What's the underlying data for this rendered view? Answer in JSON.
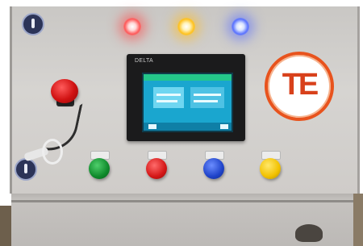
{
  "hmi": {
    "brand_text": "DELTA"
  },
  "logo": {
    "text": "TE"
  },
  "colors": {
    "panel": "#d6d4d1",
    "indicator_red": "#ff5a5a",
    "indicator_yellow": "#ffc21f",
    "indicator_blue": "#5b73ff",
    "logo_orange": "#e8531d",
    "screen_cyan": "#1aa6cf"
  },
  "components": {
    "indicator_lamps": [
      "red",
      "yellow",
      "blue"
    ],
    "push_buttons": [
      "green",
      "red",
      "blue",
      "yellow"
    ],
    "selector_switches": 2,
    "emergency_stop": "red"
  }
}
